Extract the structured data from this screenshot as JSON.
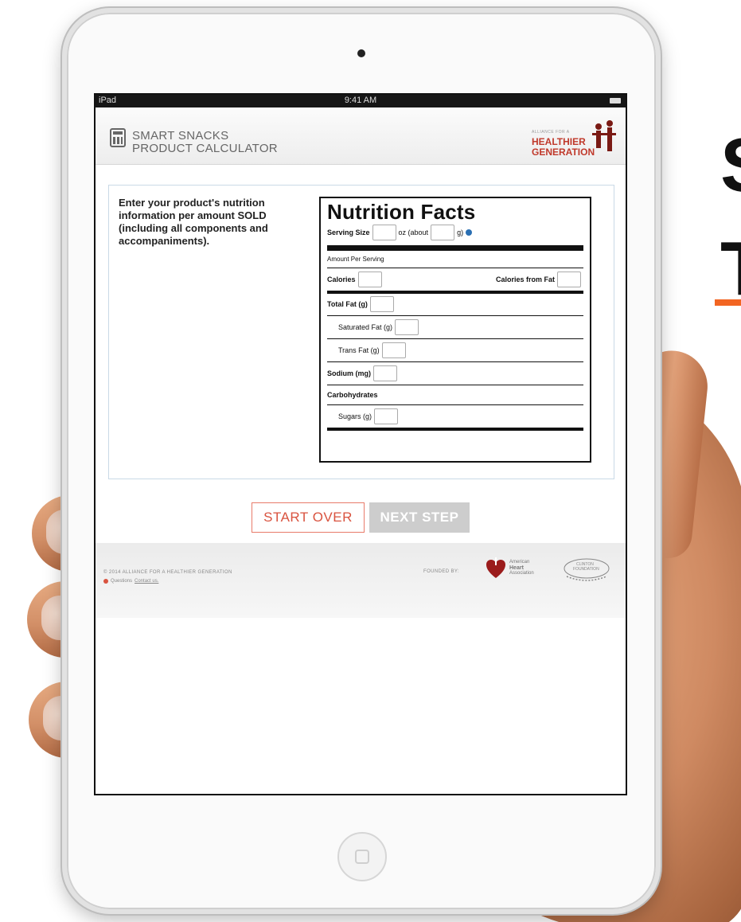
{
  "background_text": {
    "letter_1": "S",
    "letter_2": "T"
  },
  "status_bar": {
    "device": "iPad",
    "time": "9:41 AM"
  },
  "app_header": {
    "title_line1": "SMART SNACKS",
    "title_line2": "PRODUCT CALCULATOR",
    "logo_small": "ALLIANCE FOR A",
    "logo_line1": "HEALTHIER",
    "logo_line2": "GENERATION"
  },
  "intro": {
    "text": "Enter your product's nutrition information per amount SOLD (including all components and accompaniments)."
  },
  "nutrition_facts": {
    "title": "Nutrition Facts",
    "serving_size_label": "Serving Size",
    "oz_about_label": "oz (about",
    "g_label": "g)",
    "amount_per_serving": "Amount Per Serving",
    "calories_label": "Calories",
    "calories_from_fat_label": "Calories from Fat",
    "total_fat_label": "Total Fat (g)",
    "saturated_fat_label": "Saturated Fat (g)",
    "trans_fat_label": "Trans Fat (g)",
    "sodium_label": "Sodium (mg)",
    "carbohydrates_label": "Carbohydrates",
    "sugars_label": "Sugars (g)"
  },
  "buttons": {
    "start_over": "START OVER",
    "next_step": "NEXT STEP"
  },
  "footer": {
    "copyright": "© 2014 ALLIANCE FOR A HEALTHIER GENERATION",
    "questions": "Questions",
    "contact_link": "Contact us.",
    "founded_by": "FOUNDED BY:",
    "aha_line1": "American",
    "aha_line2": "Heart",
    "aha_line3": "Association",
    "clinton_line1": "CLINTON",
    "clinton_line2": "FOUNDATION"
  },
  "colors": {
    "accent_red": "#d9533f",
    "logo_red": "#c0392b",
    "underline_orange": "#f26522",
    "disabled_gray": "#cdcdcd"
  }
}
